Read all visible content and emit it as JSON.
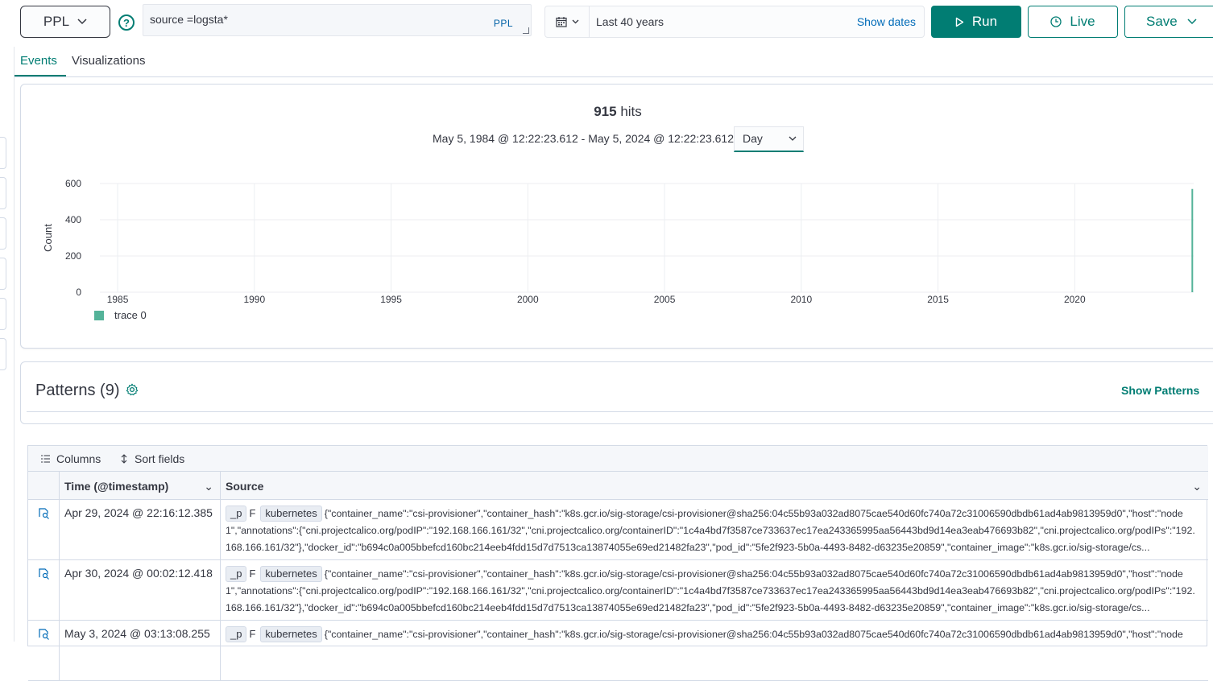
{
  "query_bar": {
    "language": "PPL",
    "query": "source =logsta*",
    "query_lang_tag": "PPL",
    "help_icon": "question-circle-icon"
  },
  "date_picker": {
    "range_label": "Last 40 years",
    "show_dates": "Show dates",
    "icon": "calendar-icon"
  },
  "actions": {
    "run": "Run",
    "live": "Live",
    "save": "Save"
  },
  "tabs": [
    {
      "label": "Events",
      "active": true
    },
    {
      "label": "Visualizations",
      "active": false
    }
  ],
  "histogram": {
    "hits_count": "915",
    "hits_suffix": " hits",
    "date_range": "May 5, 1984 @ 12:22:23.612 - May 5, 2024 @ 12:22:23.612",
    "interval": "Day"
  },
  "chart_data": {
    "type": "bar",
    "ylabel": "Count",
    "xlabel": "",
    "ylim": [
      0,
      600
    ],
    "yticks": [
      "0",
      "200",
      "400",
      "600"
    ],
    "xticks": [
      "1985",
      "1990",
      "1995",
      "2000",
      "2005",
      "2010",
      "2015",
      "2020"
    ],
    "xlim": [
      1984.35,
      2024.35
    ],
    "series": [
      {
        "name": "trace 0",
        "x": [
          2024.3
        ],
        "values": [
          570
        ]
      }
    ],
    "color": "#54b399",
    "grid": true,
    "legend": "bottom-left"
  },
  "patterns": {
    "title": "Patterns (9)",
    "show": "Show Patterns"
  },
  "grid": {
    "columns_btn": "Columns",
    "sort_btn": "Sort fields",
    "headers": [
      "Time (@timestamp)",
      "Source"
    ],
    "rows": [
      {
        "time": "Apr 29, 2024 @ 22:16:12.385",
        "tag1": "_p",
        "flag": "F",
        "tag2": "kubernetes",
        "source": "{\"container_name\":\"csi-provisioner\",\"container_hash\":\"k8s.gcr.io/sig-storage/csi-provisioner@sha256:04c55b93a032ad8075cae540d60fc740a72c31006590dbdb61ad4ab9813959d0\",\"host\":\"node1\",\"annotations\":{\"cni.projectcalico.org/podIP\":\"192.168.166.161/32\",\"cni.projectcalico.org/containerID\":\"1c4a4bd7f3587ce733637ec17ea243365995aa56443bd9d14ea3eab476693b82\",\"cni.projectcalico.org/podIPs\":\"192.168.166.161/32\"},\"docker_id\":\"b694c0a005bbefcd160bc214eeb4fdd15d7d7513ca13874055e69ed21482fa23\",\"pod_id\":\"5fe2f923-5b0a-4493-8482-d63235e20859\",\"container_image\":\"k8s.gcr.io/sig-storage/cs..."
      },
      {
        "time": "Apr 30, 2024 @ 00:02:12.418",
        "tag1": "_p",
        "flag": "F",
        "tag2": "kubernetes",
        "source": "{\"container_name\":\"csi-provisioner\",\"container_hash\":\"k8s.gcr.io/sig-storage/csi-provisioner@sha256:04c55b93a032ad8075cae540d60fc740a72c31006590dbdb61ad4ab9813959d0\",\"host\":\"node1\",\"annotations\":{\"cni.projectcalico.org/podIP\":\"192.168.166.161/32\",\"cni.projectcalico.org/containerID\":\"1c4a4bd7f3587ce733637ec17ea243365995aa56443bd9d14ea3eab476693b82\",\"cni.projectcalico.org/podIPs\":\"192.168.166.161/32\"},\"docker_id\":\"b694c0a005bbefcd160bc214eeb4fdd15d7d7513ca13874055e69ed21482fa23\",\"pod_id\":\"5fe2f923-5b0a-4493-8482-d63235e20859\",\"container_image\":\"k8s.gcr.io/sig-storage/cs..."
      },
      {
        "time": "May 3, 2024 @ 03:13:08.255",
        "tag1": "_p",
        "flag": "F",
        "tag2": "kubernetes",
        "source": "{\"container_name\":\"csi-provisioner\",\"container_hash\":\"k8s.gcr.io/sig-storage/csi-provisioner@sha256:04c55b93a032ad8075cae540d60fc740a72c31006590dbdb61ad4ab9813959d0\",\"host\":\"node"
      }
    ]
  }
}
